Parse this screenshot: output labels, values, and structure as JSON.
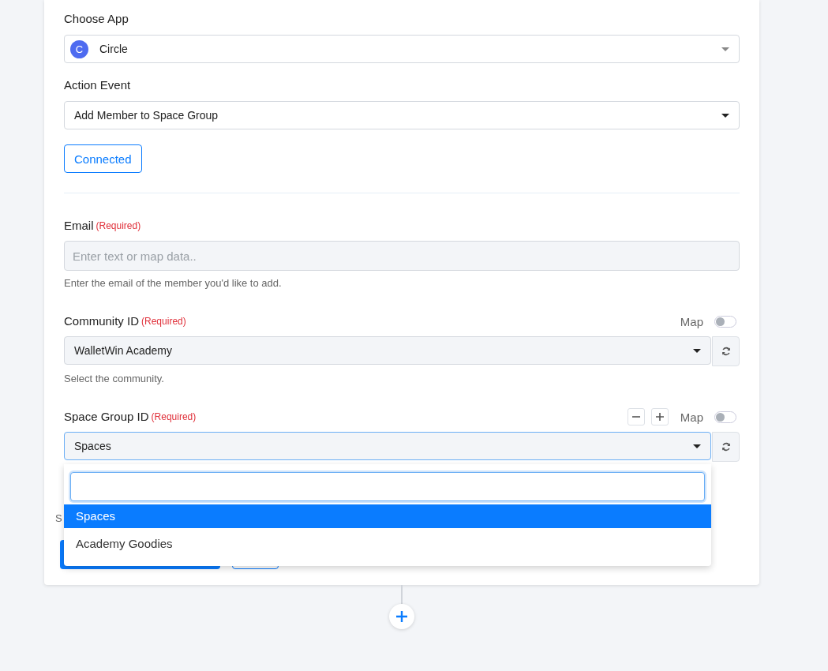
{
  "app": {
    "label": "Choose App",
    "value": "Circle",
    "icon_letter": "C"
  },
  "action": {
    "label": "Action Event",
    "value": "Add Member to Space Group"
  },
  "connection_button": "Connected",
  "fields": [
    {
      "kind": "text",
      "label": "Email",
      "required": "(Required)",
      "placeholder": "Enter text or map data..",
      "hint": "Enter the email of the member you'd like to add."
    },
    {
      "kind": "select",
      "label": "Community ID",
      "required": "(Required)",
      "map_label": "Map",
      "map_on": false,
      "value": "WalletWin Academy",
      "hint": "Select the community."
    },
    {
      "kind": "select",
      "label": "Space Group ID",
      "required": "(Required)",
      "stepper": true,
      "map_label": "Map",
      "map_on": false,
      "value": "Spaces",
      "hint": "S",
      "open": true,
      "options": [
        {
          "label": "Spaces",
          "selected": true
        },
        {
          "label": "Academy Goodies",
          "selected": false
        }
      ]
    }
  ]
}
